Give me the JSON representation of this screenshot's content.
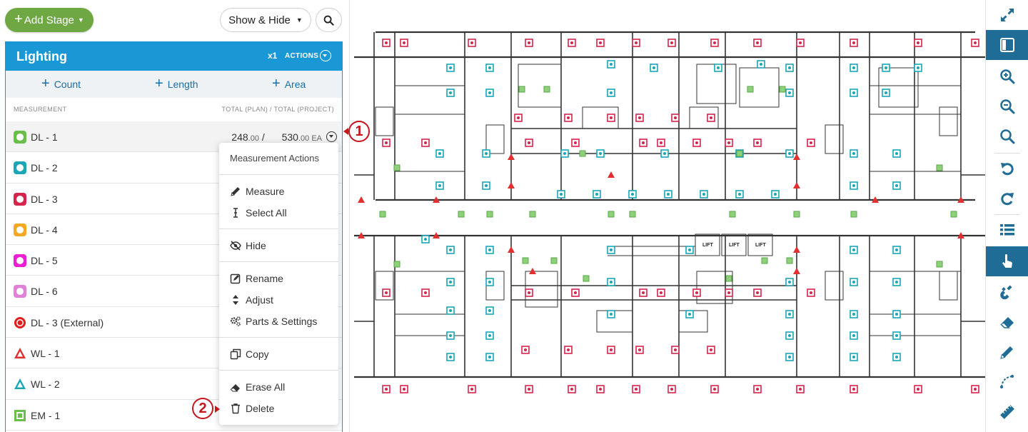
{
  "toolbar": {
    "add_stage_label": "Add Stage",
    "show_hide_label": "Show & Hide"
  },
  "stage": {
    "title": "Lighting",
    "multiplier": "x1",
    "actions_label": "ACTIONS",
    "header_color": "#1a98d5"
  },
  "measure_types": [
    {
      "label": "Count"
    },
    {
      "label": "Length"
    },
    {
      "label": "Area"
    }
  ],
  "list_header": {
    "left": "MEASUREMENT",
    "right": "TOTAL (PLAN) / TOTAL (PROJECT)"
  },
  "measurements": [
    {
      "name": "DL - 1",
      "color": "#6abf4b",
      "shape": "square-circle",
      "plan_total": "248",
      "plan_dec": ".00",
      "sep": " / ",
      "project_total": "530",
      "project_dec": ".00",
      "unit": " EA"
    },
    {
      "name": "DL - 2",
      "color": "#1aa6b7",
      "shape": "square-circle"
    },
    {
      "name": "DL - 3",
      "color": "#d6254d",
      "shape": "square-circle"
    },
    {
      "name": "DL - 4",
      "color": "#f7a823",
      "shape": "square-circle"
    },
    {
      "name": "DL - 5",
      "color": "#ec1fd2",
      "shape": "square-circle"
    },
    {
      "name": "DL - 6",
      "color": "#e27fd6",
      "shape": "square-circle"
    },
    {
      "name": "DL - 3 (External)",
      "color": "#e02020",
      "shape": "circle"
    },
    {
      "name": "WL - 1",
      "color": "#e03030",
      "shape": "triangle"
    },
    {
      "name": "WL - 2",
      "color": "#1aa6b7",
      "shape": "triangle"
    },
    {
      "name": "EM - 1",
      "color": "#6abf4b",
      "shape": "square"
    }
  ],
  "action_menu": {
    "title": "Measurement Actions",
    "items": [
      {
        "label": "Measure",
        "icon": "pencil-icon"
      },
      {
        "label": "Select All",
        "icon": "text-cursor-icon"
      },
      {
        "label": "Hide",
        "icon": "eye-slash-icon"
      },
      {
        "label": "Rename",
        "icon": "edit-box-icon"
      },
      {
        "label": "Adjust",
        "icon": "sort-arrows-icon"
      },
      {
        "label": "Parts & Settings",
        "icon": "cogs-icon"
      },
      {
        "label": "Copy",
        "icon": "copy-icon"
      },
      {
        "label": "Erase All",
        "icon": "eraser-icon"
      },
      {
        "label": "Delete",
        "icon": "trash-icon"
      }
    ]
  },
  "callouts": [
    "1",
    "2"
  ],
  "plan": {
    "lift_labels": [
      "LIFT",
      "LIFT",
      "LIFT"
    ]
  },
  "right_toolbar": [
    {
      "icon": "expand-icon",
      "active": false
    },
    {
      "icon": "split-view-icon",
      "active": true
    },
    {
      "icon": "zoom-in-icon",
      "active": false
    },
    {
      "icon": "zoom-out-icon",
      "active": false
    },
    {
      "icon": "zoom-fit-icon",
      "active": false
    },
    {
      "icon": "undo-icon",
      "active": false
    },
    {
      "icon": "redo-icon",
      "active": false
    },
    {
      "icon": "list-icon",
      "active": false
    },
    {
      "icon": "pointer-hand-icon",
      "active": true
    },
    {
      "icon": "magnet-icon",
      "active": false
    },
    {
      "icon": "eraser-icon",
      "active": false
    },
    {
      "icon": "pencil-icon",
      "active": false
    },
    {
      "icon": "arc-icon",
      "active": false
    },
    {
      "icon": "ruler-icon",
      "active": false
    }
  ]
}
